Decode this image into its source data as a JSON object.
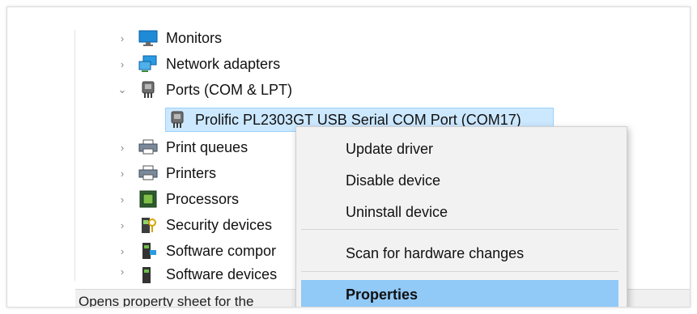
{
  "tree": {
    "items": [
      {
        "label": "Monitors",
        "expander": "collapsed",
        "icon": "monitor-icon"
      },
      {
        "label": "Network adapters",
        "expander": "collapsed",
        "icon": "network-adapter-icon"
      },
      {
        "label": "Ports (COM & LPT)",
        "expander": "expanded",
        "icon": "port-icon"
      },
      {
        "label": "Prolific PL2303GT USB Serial COM Port (COM17)",
        "expander": "none",
        "icon": "port-icon"
      },
      {
        "label": "Print queues",
        "expander": "collapsed",
        "icon": "printer-icon"
      },
      {
        "label": "Printers",
        "expander": "collapsed",
        "icon": "printer-icon"
      },
      {
        "label": "Processors",
        "expander": "collapsed",
        "icon": "processor-icon"
      },
      {
        "label": "Security devices",
        "expander": "collapsed",
        "icon": "security-device-icon"
      },
      {
        "label": "Software compor",
        "expander": "collapsed",
        "icon": "software-component-icon"
      },
      {
        "label": "Software devices",
        "expander": "collapsed",
        "icon": "software-device-icon"
      }
    ]
  },
  "context_menu": {
    "items": [
      {
        "label": "Update driver"
      },
      {
        "label": "Disable device"
      },
      {
        "label": "Uninstall device"
      },
      {
        "label": "Scan for hardware changes"
      },
      {
        "label": "Properties"
      }
    ]
  },
  "status_bar": {
    "text": "Opens property sheet for the"
  },
  "colors": {
    "selection": "#cce8ff",
    "menu_highlight": "#91c9f7",
    "menu_background": "#f2f2f2"
  }
}
